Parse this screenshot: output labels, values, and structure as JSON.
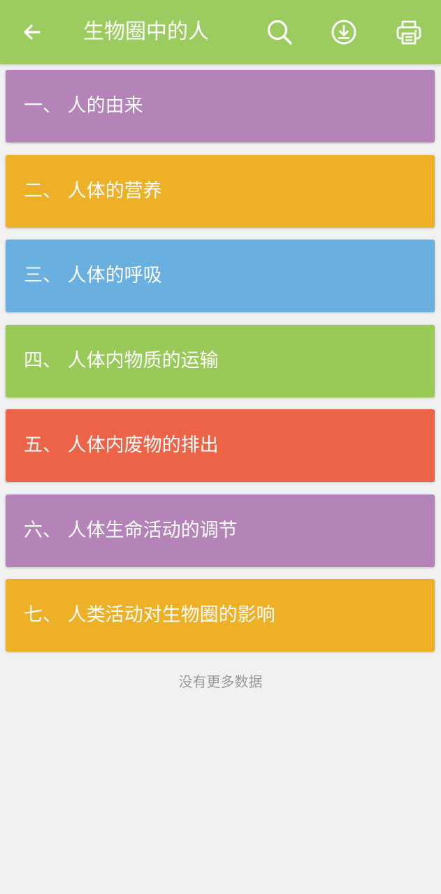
{
  "header": {
    "title": "生物圈中的人",
    "back_icon": "arrow-left-icon",
    "actions": [
      "search-icon",
      "download-icon",
      "print-icon"
    ],
    "background": "#9ccc5f"
  },
  "chapters": [
    {
      "label": "一、 人的由来",
      "color": "#b483b8"
    },
    {
      "label": "二、 人体的营养",
      "color": "#eeb026"
    },
    {
      "label": "三、 人体的呼吸",
      "color": "#69afe0"
    },
    {
      "label": "四、 人体内物质的运输",
      "color": "#99c957"
    },
    {
      "label": "五、 人体内废物的排出",
      "color": "#ec6347"
    },
    {
      "label": "六、 人体生命活动的调节",
      "color": "#b483b8"
    },
    {
      "label": "七、 人类活动对生物圈的影响",
      "color": "#eeb026"
    }
  ],
  "footer": {
    "no_more_text": "没有更多数据"
  }
}
